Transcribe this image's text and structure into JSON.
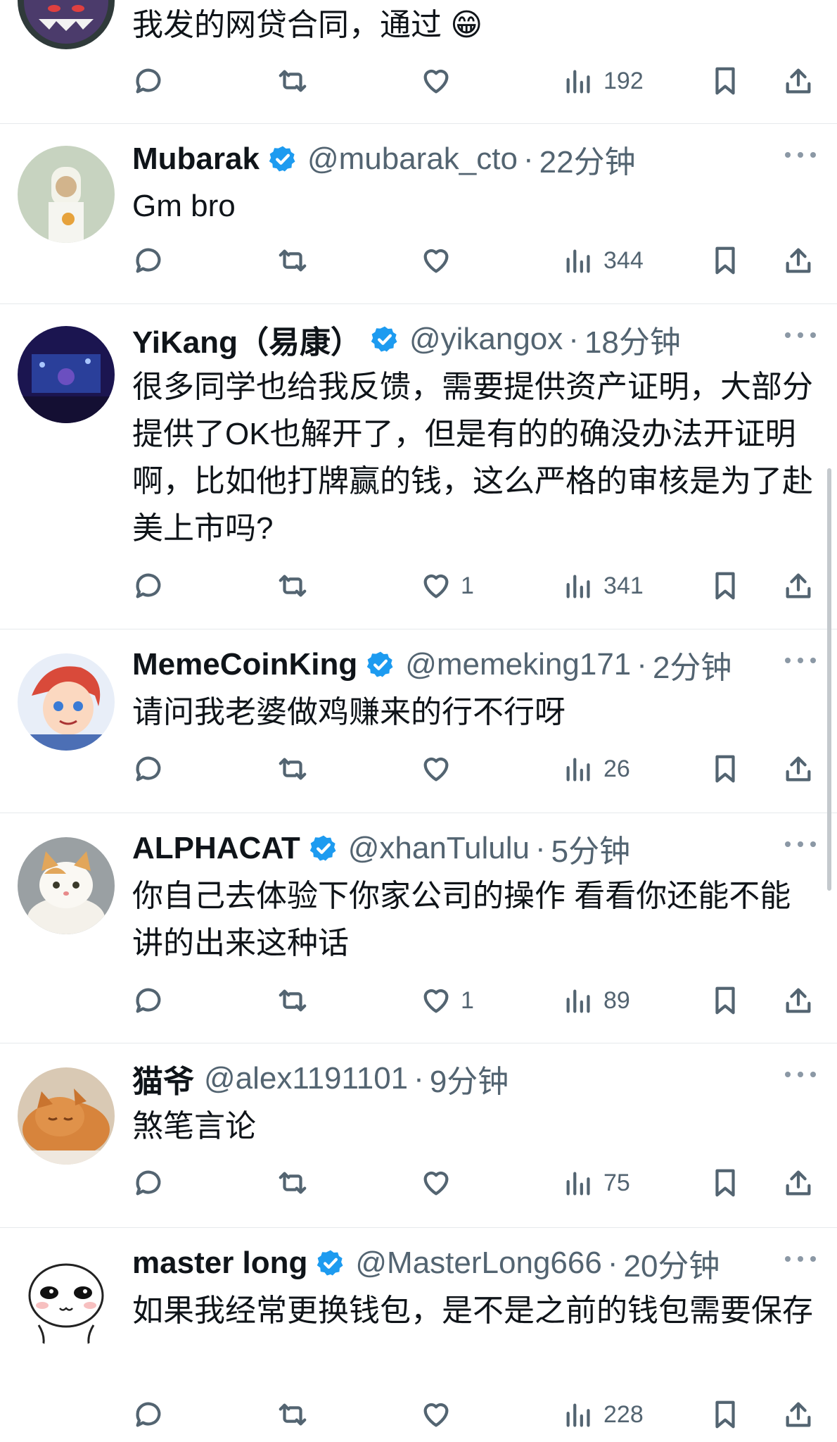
{
  "tweets": [
    {
      "text": "我发的网贷合同，通过 😁",
      "avatar": "purple-ghost-avatar",
      "stats": {
        "reply": "",
        "retweet": "",
        "like": "",
        "views": "192"
      }
    },
    {
      "name": "Mubarak",
      "verified": true,
      "handle": "@mubarak_cto",
      "sep": "·",
      "time": "22分钟",
      "text": "Gm bro",
      "avatar": "cartoon-sheikh-avatar",
      "stats": {
        "reply": "",
        "retweet": "",
        "like": "",
        "views": "344"
      }
    },
    {
      "name": "YiKang（易康）",
      "verified": true,
      "handle": "@yikangox",
      "sep": "·",
      "time": "18分钟",
      "text": "很多同学也给我反馈，需要提供资产证明，大部分提供了OK也解开了，但是有的的确没办法开证明啊，比如他打牌赢的钱，这么严格的审核是为了赴美上市吗?",
      "avatar": "stage-photo-avatar",
      "stats": {
        "reply": "",
        "retweet": "",
        "like": "1",
        "views": "341"
      }
    },
    {
      "name": "MemeCoinKing",
      "verified": true,
      "handle": "@memeking171",
      "sep": "·",
      "time": "2分钟",
      "text": "请问我老婆做鸡赚来的行不行呀",
      "avatar": "anime-boy-avatar",
      "stats": {
        "reply": "",
        "retweet": "",
        "like": "",
        "views": "26"
      }
    },
    {
      "name": "ALPHACAT",
      "verified": true,
      "handle": "@xhanTululu",
      "sep": "·",
      "time": "5分钟",
      "text": "你自己去体验下你家公司的操作 看看你还能不能讲的出来这种话",
      "avatar": "white-orange-cat-avatar",
      "stats": {
        "reply": "",
        "retweet": "",
        "like": "1",
        "views": "89"
      }
    },
    {
      "name": "猫爷",
      "verified": false,
      "handle": "@alex1191101",
      "sep": "·",
      "time": "9分钟",
      "text": "煞笔言论",
      "avatar": "sleeping-orange-cat-avatar",
      "stats": {
        "reply": "",
        "retweet": "",
        "like": "",
        "views": "75"
      }
    },
    {
      "name": "master long",
      "verified": true,
      "handle": "@MasterLong666",
      "sep": "·",
      "time": "20分钟",
      "text": "如果我经常更换钱包，是不是之前的钱包需要保存",
      "avatar": "cute-face-avatar",
      "stats": {
        "reply": "",
        "retweet": "",
        "like": "",
        "views": "228"
      }
    }
  ],
  "colors": {
    "text": "#0f1419",
    "secondary": "#536471",
    "verified": "#1d9bf0",
    "divider": "#e6e9ec"
  },
  "icons": [
    "reply-icon",
    "retweet-icon",
    "like-icon",
    "views-icon",
    "bookmark-icon",
    "share-icon",
    "verified-badge-icon",
    "more-icon"
  ]
}
